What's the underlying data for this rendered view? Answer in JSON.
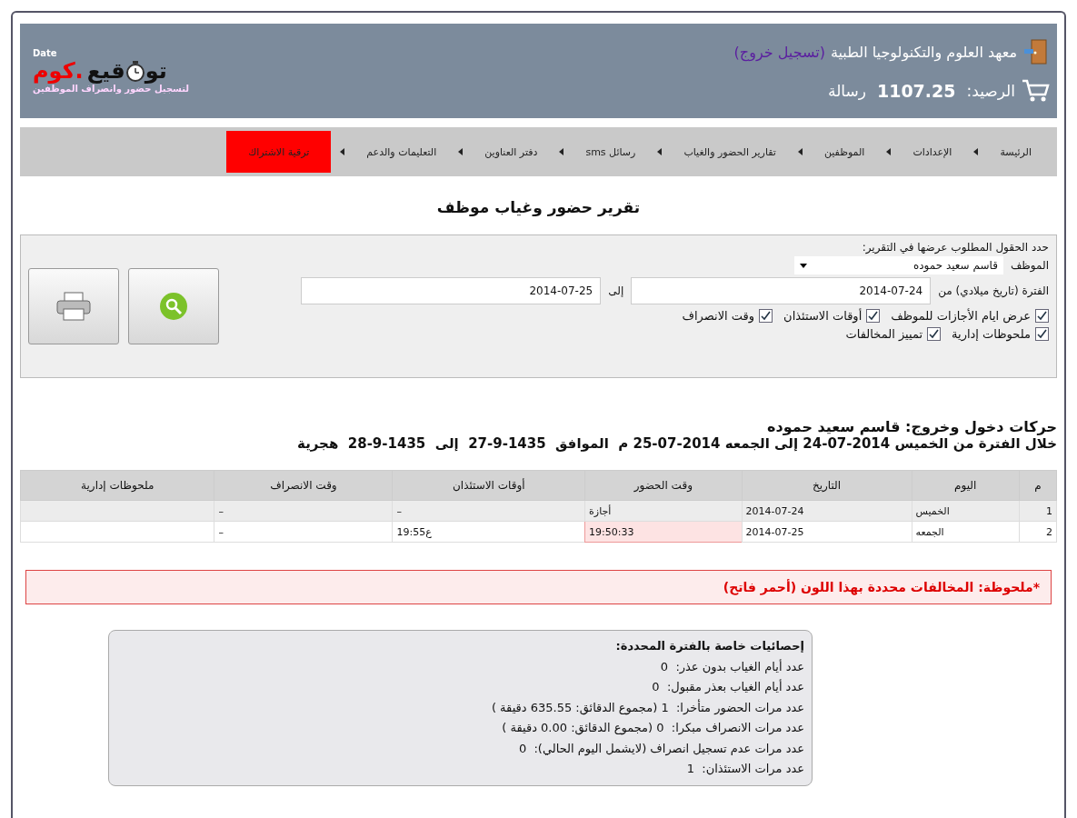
{
  "header": {
    "institution": "معهد العلوم والتكنولوجيا الطبية",
    "logout": "(تسجيل خروج)",
    "balance_label": "الرصيد:",
    "balance": "1107.25",
    "balance_unit": "رسالة",
    "logo": {
      "brand_a": "تو",
      "brand_b": "قيع",
      "brand_c": ".كوم",
      "tag": "Date",
      "subtitle": "لتسجيل حضور وانصراف الموظفين"
    }
  },
  "nav": [
    {
      "label": "الرئيسة",
      "kind": "link"
    },
    {
      "label": "الإعدادات",
      "kind": "link"
    },
    {
      "label": "الموظفين",
      "kind": "link"
    },
    {
      "label": "تقارير الحضور والغياب",
      "kind": "link"
    },
    {
      "label": "رسائل sms",
      "kind": "link"
    },
    {
      "label": "دفتر العناوين",
      "kind": "link"
    },
    {
      "label": "التعليمات والدعم",
      "kind": "link"
    },
    {
      "label": "ترقية الاشتراك",
      "kind": "upgrade"
    }
  ],
  "page_title": "تقرير حضور وغياب موظف",
  "filter": {
    "heading": "حدد الحقول المطلوب عرضها في التقرير:",
    "employee_label": "الموظف",
    "employee": "قاسم سعيد حموده",
    "period_label": "الفترة (تاريخ ميلادي) من",
    "from": "2014-07-24",
    "to_label": "إلى",
    "to": "2014-07-25",
    "options": [
      [
        {
          "label": "عرض ايام الأجازات للموظف",
          "checked": true
        },
        {
          "label": "أوقات الاستئذان",
          "checked": true
        },
        {
          "label": "وقت الانصراف",
          "checked": true
        }
      ],
      [
        {
          "label": "ملحوظات إدارية",
          "checked": true
        },
        {
          "label": "تمييز المخالفات",
          "checked": true
        }
      ]
    ]
  },
  "report": {
    "employee_line": "حركات دخول وخروج: قاسم سعيد حموده",
    "period_line": "خلال الفترة من الخميس 2014-07-24 إلى الجمعه 2014-07-25 م  الموافق  1435-9-27  إلى  1435-9-28  هجرية"
  },
  "table": {
    "columns": [
      "م",
      "اليوم",
      "التاريخ",
      "وقت الحضور",
      "أوقات الاستئذان",
      "وقت الانصراف",
      "ملحوظات إدارية"
    ],
    "rows": [
      [
        {
          "text": "1",
          "violation": false
        },
        {
          "text": "الخميس",
          "violation": false
        },
        {
          "text": "2014-07-24",
          "violation": false
        },
        {
          "text": "أجازة",
          "violation": false
        },
        {
          "text": "–",
          "violation": false
        },
        {
          "text": "–",
          "violation": false
        }
      ],
      [
        {
          "text": "2",
          "violation": false
        },
        {
          "text": "الجمعه",
          "violation": false
        },
        {
          "text": "2014-07-25",
          "violation": false
        },
        {
          "text": "19:50:33",
          "violation": true
        },
        {
          "text": "ع19:55",
          "violation": false
        },
        {
          "text": "–",
          "violation": false
        }
      ]
    ]
  },
  "note": "*ملحوظة: المخالفات محددة بهذا اللون (أحمر فاتح)",
  "stats": {
    "title": "إحصائيات خاصة بالفترة المحددة:",
    "lines": [
      "عدد أيام الغياب بدون عذر:  0",
      "عدد أيام الغياب بعذر مقبول:  0",
      "عدد مرات الحضور متأخرا:  1 (مجموع الدقائق: 635.55 دقيقة )",
      "عدد مرات الانصراف مبكرا:  0 (مجموع الدقائق: 0.00 دقيقة )",
      "عدد مرات عدم تسجيل انصراف (لايشمل اليوم الحالي):  0",
      "عدد مرات الاستئذان:  1"
    ]
  }
}
